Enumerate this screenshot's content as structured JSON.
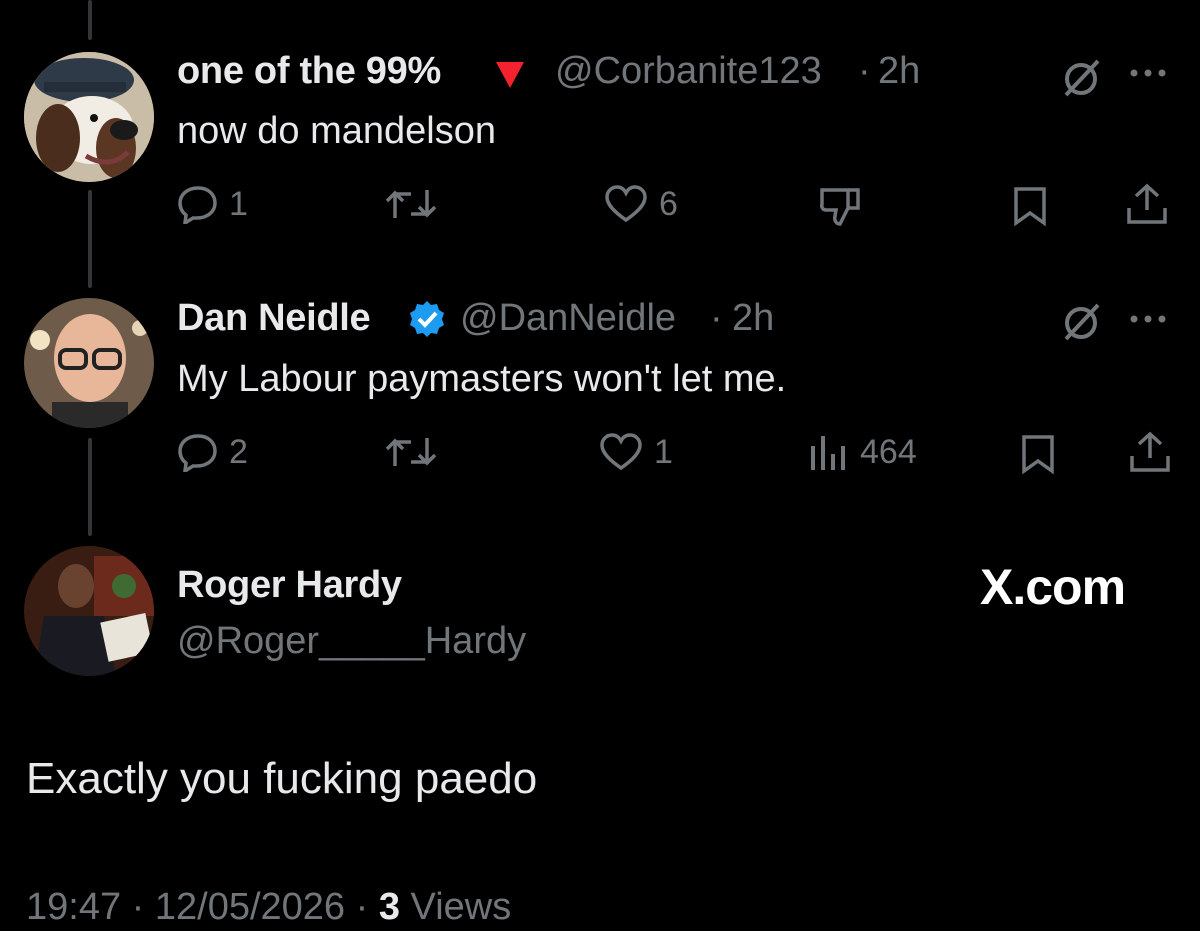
{
  "replies": [
    {
      "display_name": "one of the 99%",
      "badge": "red-triangle-down",
      "handle": "@Corbanite123",
      "time": "2h",
      "text": "now do mandelson",
      "replies": "1",
      "reposts": "",
      "likes": "6",
      "extra_action": "dislike"
    },
    {
      "display_name": "Dan Neidle",
      "badge": "verified-blue",
      "handle": "@DanNeidle",
      "time": "2h",
      "text": "My Labour paymasters won't let me.",
      "replies": "2",
      "reposts": "",
      "likes": "1",
      "views": "464"
    }
  ],
  "main_post": {
    "display_name": "Roger Hardy",
    "handle": "@Roger_____Hardy",
    "brand": "X.com",
    "text": "Exactly you fucking paedo",
    "time": "19:47",
    "date": "12/05/2026",
    "views_count": "3",
    "views_label": "Views"
  },
  "colors": {
    "background": "#000000",
    "text": "#e7e9ea",
    "muted": "#71767b",
    "verified": "#1d9bf0",
    "red_badge": "#f4212e"
  }
}
